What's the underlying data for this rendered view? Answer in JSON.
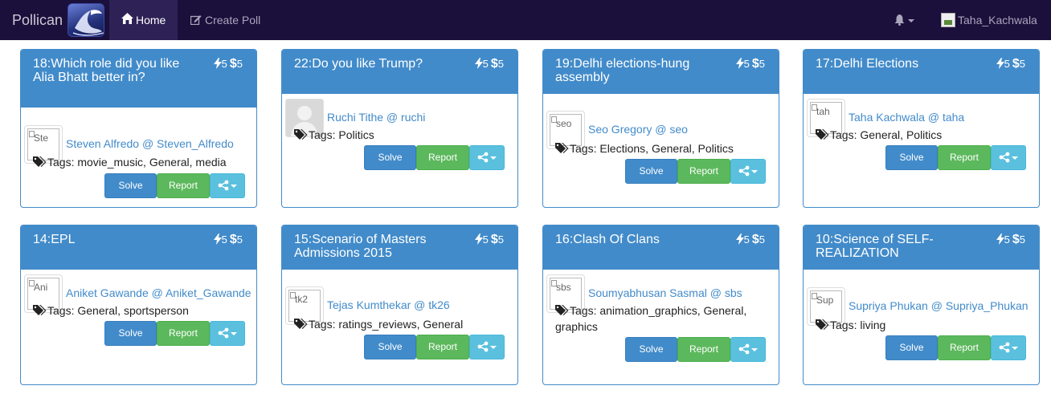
{
  "nav": {
    "brand": "Pollican",
    "home_label": "Home",
    "create_label": "Create Poll",
    "username": "Taha_Kachwala"
  },
  "buttons": {
    "solve": "Solve",
    "report": "Report"
  },
  "cards": [
    {
      "title": "18:Which role did you like Alia Bhatt better in?",
      "bolt": "5",
      "dollar": "5",
      "author": "Steven Alfredo @ Steven_Alfredo",
      "avatar_alt": "Ste",
      "tags_label": "Tags:",
      "tags": "movie_music, General, media"
    },
    {
      "title": "22:Do you like Trump?",
      "bolt": "5",
      "dollar": "5",
      "author": "Ruchi Tithe @ ruchi",
      "avatar_alt": "",
      "tags_label": "Tags:",
      "tags": "Politics"
    },
    {
      "title": "19:Delhi elections-hung assembly",
      "bolt": "5",
      "dollar": "5",
      "author": "Seo Gregory @ seo",
      "avatar_alt": "seo",
      "tags_label": "Tags:",
      "tags": "Elections, General, Politics"
    },
    {
      "title": "17:Delhi Elections",
      "bolt": "5",
      "dollar": "5",
      "author": "Taha Kachwala @ taha",
      "avatar_alt": "tah",
      "tags_label": "Tags:",
      "tags": "General, Politics"
    },
    {
      "title": "14:EPL",
      "bolt": "5",
      "dollar": "5",
      "author": "Aniket Gawande @ Aniket_Gawande",
      "avatar_alt": "Ani",
      "tags_label": "Tags:",
      "tags": "General, sportsperson"
    },
    {
      "title": "15:Scenario of Masters Admissions 2015",
      "bolt": "5",
      "dollar": "5",
      "author": "Tejas Kumthekar @ tk26",
      "avatar_alt": "tk2",
      "tags_label": "Tags:",
      "tags": "ratings_reviews, General"
    },
    {
      "title": "16:Clash Of Clans",
      "bolt": "5",
      "dollar": "5",
      "author": "Soumyabhusan Sasmal @ sbs",
      "avatar_alt": "sbs",
      "tags_label": "Tags:",
      "tags": "animation_graphics, General, graphics"
    },
    {
      "title": "10:Science of SELF-REALIZATION",
      "bolt": "5",
      "dollar": "5",
      "author": "Supriya Phukan @ Supriya_Phukan",
      "avatar_alt": "Sup",
      "tags_label": "Tags:",
      "tags": "living"
    }
  ]
}
